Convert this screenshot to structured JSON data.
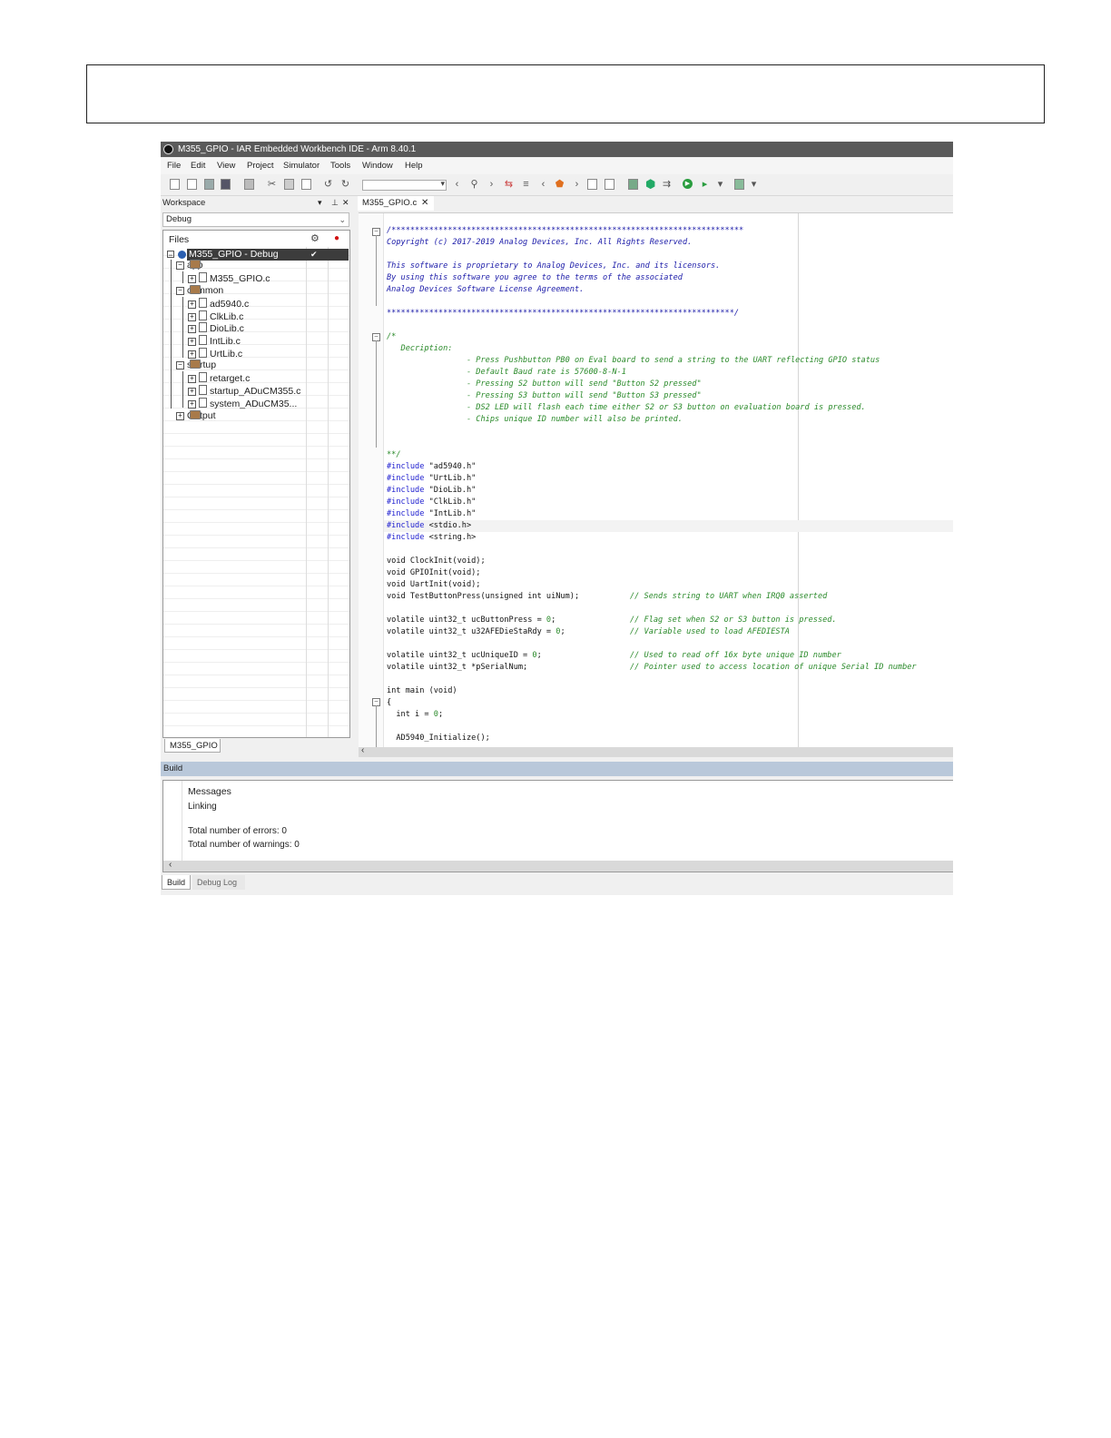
{
  "window": {
    "title": "M355_GPIO - IAR Embedded Workbench IDE - Arm 8.40.1"
  },
  "menu": [
    "File",
    "Edit",
    "View",
    "Project",
    "Simulator",
    "Tools",
    "Window",
    "Help"
  ],
  "workspace": {
    "header": "Workspace",
    "configuration": "Debug",
    "files_header": "Files",
    "project": "M355_GPIO - Debug",
    "tree": [
      {
        "label": "app",
        "type": "folder"
      },
      {
        "label": "M355_GPIO.c",
        "type": "file"
      },
      {
        "label": "common",
        "type": "folder"
      },
      {
        "label": "ad5940.c",
        "type": "file"
      },
      {
        "label": "ClkLib.c",
        "type": "file"
      },
      {
        "label": "DioLib.c",
        "type": "file"
      },
      {
        "label": "IntLib.c",
        "type": "file"
      },
      {
        "label": "UrtLib.c",
        "type": "file"
      },
      {
        "label": "startup",
        "type": "folder"
      },
      {
        "label": "retarget.c",
        "type": "file"
      },
      {
        "label": "startup_ADuCM355.c",
        "type": "file"
      },
      {
        "label": "system_ADuCM35...",
        "type": "file"
      },
      {
        "label": "Output",
        "type": "folder"
      }
    ],
    "tab": "M355_GPIO"
  },
  "editor": {
    "tab": "M355_GPIO.c",
    "code": {
      "l01": "/***************************************************************************",
      "l02": "Copyright (c) 2017-2019 Analog Devices, Inc. All Rights Reserved.",
      "l03": "This software is proprietary to Analog Devices, Inc. and its licensors.",
      "l04": "By using this software you agree to the terms of the associated",
      "l05": "Analog Devices Software License Agreement.",
      "l06": "**************************************************************************/",
      "l07": "/*",
      "l08": "   Decription:",
      "l09": "                 - Press Pushbutton PB0 on Eval board to send a string to the UART reflecting GPIO status",
      "l10": "                 - Default Baud rate is 57600-8-N-1",
      "l11": "                 - Pressing S2 button will send \"Button S2 pressed\"",
      "l12": "                 - Pressing S3 button will send \"Button S3 pressed\"",
      "l13": "                 - DS2 LED will flash each time either S2 or S3 button on evaluation board is pressed.",
      "l14": "                 - Chips unique ID number will also be printed.",
      "l15": "**/",
      "inc_kw": "#include",
      "inc1": " \"ad5940.h\"",
      "inc2": " \"UrtLib.h\"",
      "inc3": " \"DioLib.h\"",
      "inc4": " \"ClkLib.h\"",
      "inc5": " \"IntLib.h\"",
      "inc6": " <stdio.h>",
      "inc7": " <string.h>",
      "p1": "void ClockInit(void);",
      "p2": "void GPIOInit(void);",
      "p3": "void UartInit(void);",
      "p4": "void TestButtonPress(unsigned int uiNum);",
      "c4": "// Sends string to UART when IRQ0 asserted",
      "v1": "volatile uint32_t ucButtonPress = ",
      "v2": "volatile uint32_t u32AFEDieStaRdy = ",
      "zero": "0",
      "semi": ";",
      "c5": "// Flag set when S2 or S3 button is pressed.",
      "c6": "// Variable used to load AFEDIESTA",
      "v3": "volatile uint32_t ucUniqueID = ",
      "v4": "volatile uint32_t *pSerialNum;",
      "c7": "// Used to read off 16x byte unique ID number",
      "c8": "// Pointer used to access location of unique Serial ID number",
      "m1": "int main (void)",
      "m2": "{",
      "m3": "  int i = ",
      "m4": "  AD5940_Initialize();"
    }
  },
  "build": {
    "header": "Build",
    "messages_header": "Messages",
    "lines": [
      "Linking",
      "Total number of errors: 0",
      "Total number of warnings: 0"
    ],
    "tabs": [
      "Build",
      "Debug Log"
    ]
  }
}
